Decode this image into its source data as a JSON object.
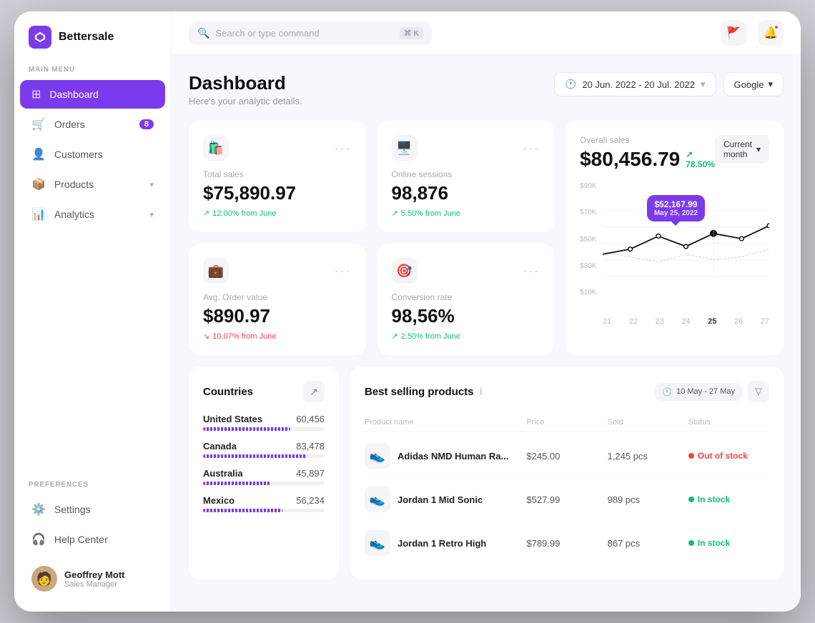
{
  "app": {
    "name": "Bettersale"
  },
  "topbar": {
    "search_placeholder": "Search or type command",
    "search_shortcut": "⌘ K",
    "date_range": "20 Jun. 2022 - 20 Jul. 2022",
    "source": "Google"
  },
  "sidebar": {
    "main_menu_label": "MAIN MENU",
    "preferences_label": "PREFERENCES",
    "nav_items": [
      {
        "id": "dashboard",
        "label": "Dashboard",
        "active": true,
        "badge": null,
        "has_chevron": false
      },
      {
        "id": "orders",
        "label": "Orders",
        "active": false,
        "badge": "8",
        "has_chevron": false
      },
      {
        "id": "customers",
        "label": "Customers",
        "active": false,
        "badge": null,
        "has_chevron": false
      },
      {
        "id": "products",
        "label": "Products",
        "active": false,
        "badge": null,
        "has_chevron": true
      },
      {
        "id": "analytics",
        "label": "Analytics",
        "active": false,
        "badge": null,
        "has_chevron": true
      }
    ],
    "pref_items": [
      {
        "id": "settings",
        "label": "Settings"
      },
      {
        "id": "help",
        "label": "Help Center"
      }
    ],
    "user": {
      "name": "Geoffrey Mott",
      "role": "Sales Manager"
    }
  },
  "page": {
    "title": "Dashboard",
    "subtitle": "Here's your analytic details."
  },
  "stats": [
    {
      "id": "total-sales",
      "label": "Total sales",
      "value": "$75,890.97",
      "change": "12.00% from June",
      "change_dir": "up",
      "icon": "🛍️"
    },
    {
      "id": "online-sessions",
      "label": "Online sessions",
      "value": "98,876",
      "change": "5.50% from June",
      "change_dir": "up",
      "icon": "🖥️"
    },
    {
      "id": "avg-order",
      "label": "Avg. Order value",
      "value": "$890.97",
      "change": "10.07% from June",
      "change_dir": "down",
      "icon": "💼"
    },
    {
      "id": "conversion",
      "label": "Conversion rate",
      "value": "98,56%",
      "change": "2.50% from June",
      "change_dir": "up",
      "icon": "🎯"
    }
  ],
  "overall": {
    "label": "Overall sales",
    "value": "$80,456.79",
    "change": "78.50%",
    "period": "Current month",
    "tooltip_value": "$52,167.99",
    "tooltip_date": "May 25, 2022",
    "x_labels": [
      "21",
      "22",
      "23",
      "24",
      "25",
      "26",
      "27"
    ],
    "y_labels": [
      "$90K",
      "$70K",
      "$50K",
      "$30K",
      "$10K"
    ]
  },
  "countries": {
    "title": "Countries",
    "items": [
      {
        "name": "United States",
        "value": "60,456",
        "pct": 72
      },
      {
        "name": "Canada",
        "value": "83,478",
        "pct": 85
      },
      {
        "name": "Australia",
        "value": "45,897",
        "pct": 55
      },
      {
        "name": "Mexico",
        "value": "56,234",
        "pct": 65
      }
    ]
  },
  "products": {
    "title": "Best selling products",
    "date_range": "10 May - 27 May",
    "columns": [
      "Product name",
      "Price",
      "Sold",
      "Status"
    ],
    "items": [
      {
        "name": "Adidas NMD Human Ra...",
        "price": "$245.00",
        "sold": "1,245 pcs",
        "status": "Out of stock",
        "status_type": "out",
        "icon": "👟"
      },
      {
        "name": "Jordan 1 Mid Sonic",
        "price": "$527.99",
        "sold": "989 pcs",
        "status": "In stock",
        "status_type": "in",
        "icon": "👟"
      },
      {
        "name": "Jordan 1 Retro High",
        "price": "$789.99",
        "sold": "867 pcs",
        "status": "In stock",
        "status_type": "in",
        "icon": "👟"
      }
    ]
  }
}
